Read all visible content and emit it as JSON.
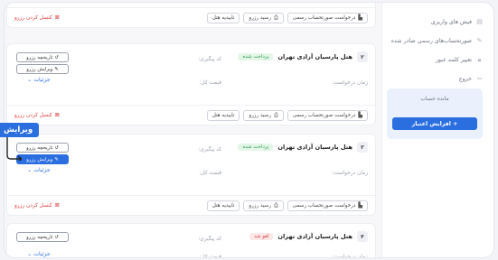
{
  "sidebar": {
    "items": [
      {
        "label": "فیش های واریزی",
        "icon": "receipt-icon"
      },
      {
        "label": "صورتحساب‌های رسمی صادر شده",
        "icon": "invoice-icon"
      },
      {
        "label": "تغییر کلمه عبور",
        "icon": "lock-icon"
      },
      {
        "label": "خروج",
        "icon": "logout-icon"
      }
    ],
    "wallet": {
      "title": "مانده حساب",
      "charge_label": "+ افزایش اعتبار"
    }
  },
  "actions": {
    "request_invoice": "درخواست صورتحساب رسمی",
    "reserve_receipt": "رسید رزرو",
    "hotel_confirm": "تاییدیه هتل",
    "cancel_reserve": "کنسل کردن رزرو",
    "reserve_history": "تاریخچه رزرو",
    "edit_reserve": "ویرایش رزرو",
    "details": "جزئیات"
  },
  "fields": {
    "tracking_code": "کد پیگیری:",
    "request_time": "زمان درخواست:",
    "total_price": "قیمت کل:"
  },
  "reservations": [
    {
      "number": "۲",
      "hotel": "هتل پارسیان آزادی تهران",
      "status": "پرداخت شده"
    },
    {
      "number": "۳",
      "hotel": "هتل پارسیان آزادی تهران",
      "status": "پرداخت شده"
    },
    {
      "number": "۴",
      "hotel": "هتل پارسیان آزادی تهران",
      "status": "لغو شد"
    }
  ],
  "callout": {
    "label": "ویرایش"
  },
  "colors": {
    "accent": "#2a6ee0",
    "danger": "#d93b3b",
    "success": "#2e9b51"
  }
}
